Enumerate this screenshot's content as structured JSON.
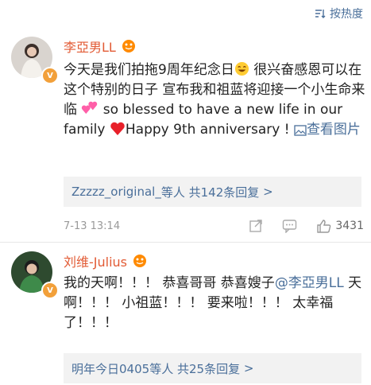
{
  "sort": {
    "label": "按热度"
  },
  "comments": [
    {
      "username": "李亞男LL",
      "text_part1": "今天是我们拍拖9周年纪念日",
      "text_part2": " 很兴奋感恩可以在这个特别的日子 宣布我和祖蓝将迎接一个小生命来临",
      "text_part3": " so blessed to have a new life in our family ",
      "text_part4": "Happy 9th anniversary ! ",
      "view_image_label": "查看图片",
      "replies": {
        "names": "Zzzzz_original_",
        "suffix": "等人",
        "count_text": "共142条回复",
        "arrow": ">"
      },
      "time": "7-13 13:14",
      "like_count": "3431"
    },
    {
      "username": "刘维-Julius",
      "text_part1": "我的天啊！！！ 恭喜哥哥 恭喜嫂子",
      "mention": "@李亞男LL",
      "text_part2": " 天啊！！！ 小祖蓝！！！ 要来啦！！！ 太幸福了！！！",
      "replies": {
        "names": "明年今日0405",
        "suffix": "等人",
        "count_text": "共25条回复",
        "arrow": ">"
      }
    }
  ],
  "colors": {
    "link": "#4a6f9a",
    "username": "#e25b35",
    "verified": "#f2a03a"
  },
  "icons": [
    "sort-icon",
    "level-badge-icon",
    "grin-emoji-icon",
    "two-hearts-emoji-icon",
    "red-heart-emoji-icon",
    "image-link-icon",
    "share-icon",
    "comment-icon",
    "like-icon",
    "verified-badge-icon"
  ]
}
